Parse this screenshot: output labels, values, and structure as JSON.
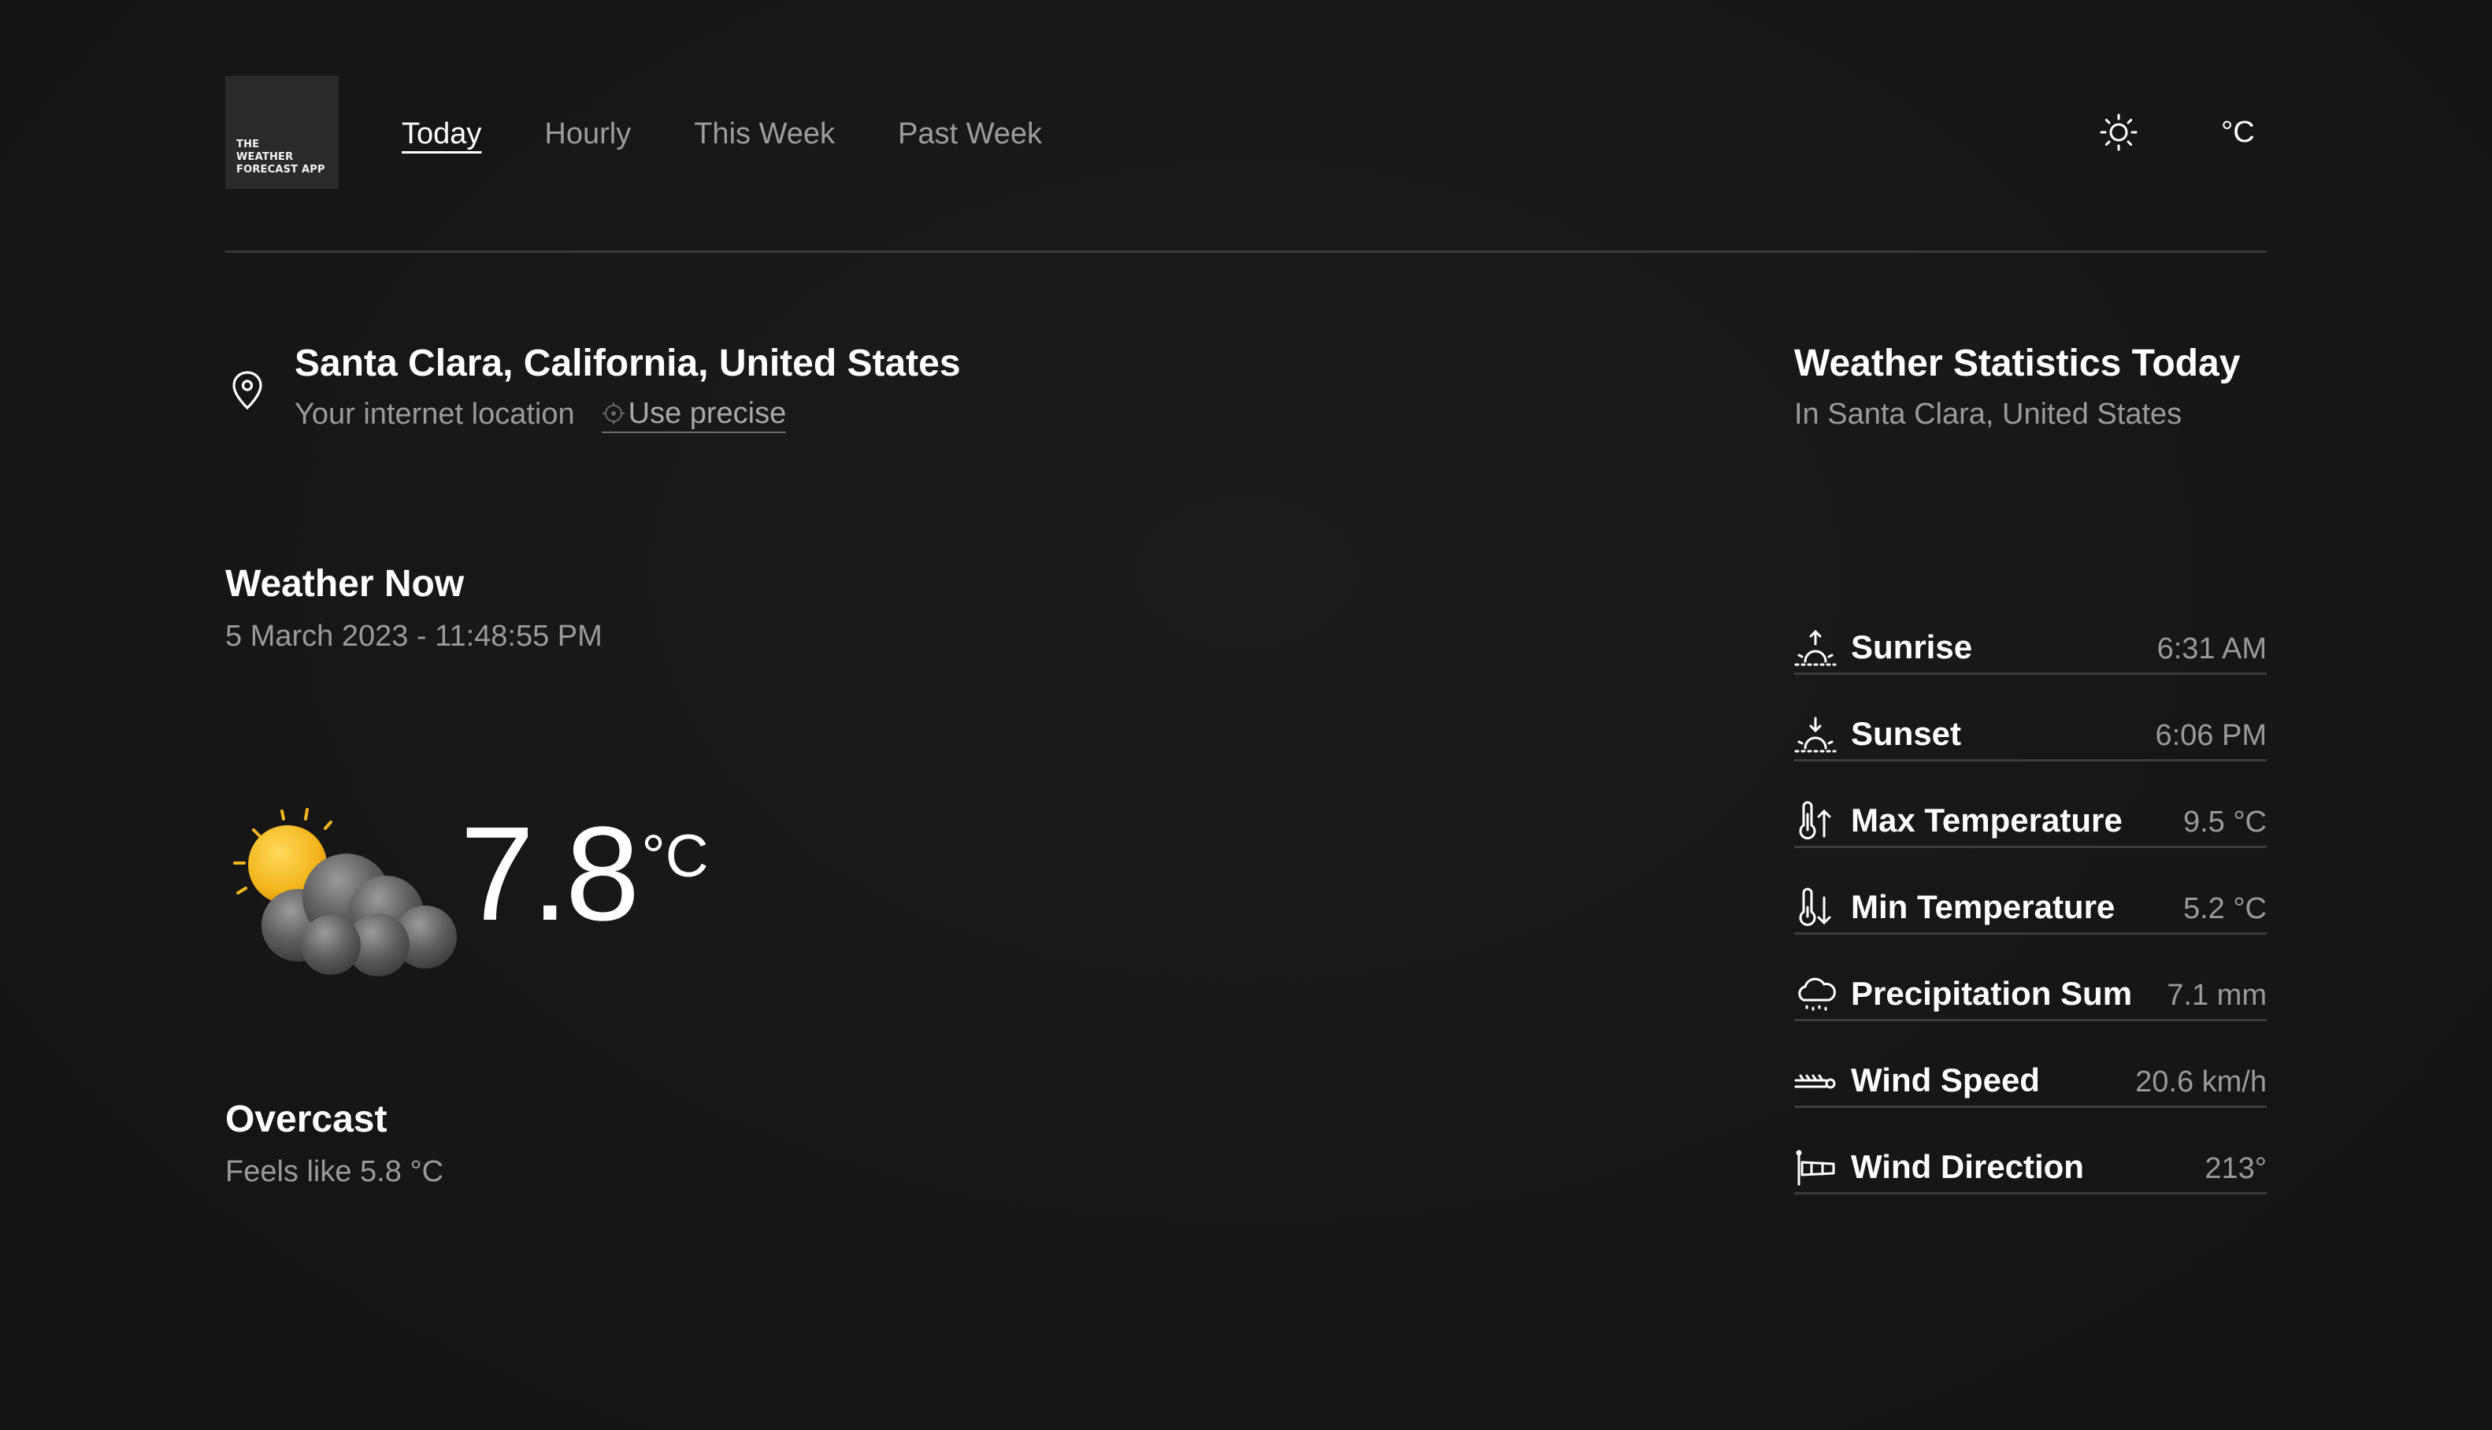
{
  "app": {
    "logo_text": "THE\nWEATHER\nFORECAST APP"
  },
  "nav": {
    "items": [
      {
        "label": "Today",
        "active": true
      },
      {
        "label": "Hourly",
        "active": false
      },
      {
        "label": "This Week",
        "active": false
      },
      {
        "label": "Past Week",
        "active": false
      }
    ]
  },
  "toolbar": {
    "theme_icon": "sun-icon",
    "unit_label": "°C"
  },
  "location": {
    "name": "Santa Clara, California, United States",
    "source_label": "Your internet location",
    "precise_label": "Use precise",
    "icon": "map-pin-icon"
  },
  "now": {
    "title": "Weather Now",
    "datetime": "5 March 2023 - 11:48:55 PM",
    "icon": "partly-cloudy-icon",
    "temperature": "7.8",
    "unit": "°C",
    "condition": "Overcast",
    "feels_like": "Feels like 5.8 °C"
  },
  "stats": {
    "title": "Weather Statistics Today",
    "subtitle": "In Santa Clara, United States",
    "items": [
      {
        "label": "Sunrise",
        "value": "6:31 AM",
        "icon": "sunrise-icon"
      },
      {
        "label": "Sunset",
        "value": "6:06 PM",
        "icon": "sunset-icon"
      },
      {
        "label": "Max Temperature",
        "value": "9.5 °C",
        "icon": "thermometer-up-icon"
      },
      {
        "label": "Min Temperature",
        "value": "5.2 °C",
        "icon": "thermometer-down-icon"
      },
      {
        "label": "Precipitation Sum",
        "value": "7.1 mm",
        "icon": "rain-cloud-icon"
      },
      {
        "label": "Wind Speed",
        "value": "20.6 km/h",
        "icon": "wind-icon"
      },
      {
        "label": "Wind Direction",
        "value": "213°",
        "icon": "windsock-icon"
      }
    ]
  },
  "colors": {
    "background": "#161616",
    "text_primary": "#ffffff",
    "text_secondary": "#9a9a9a",
    "divider": "#3a3a3a",
    "sun": "#f2b51c"
  }
}
